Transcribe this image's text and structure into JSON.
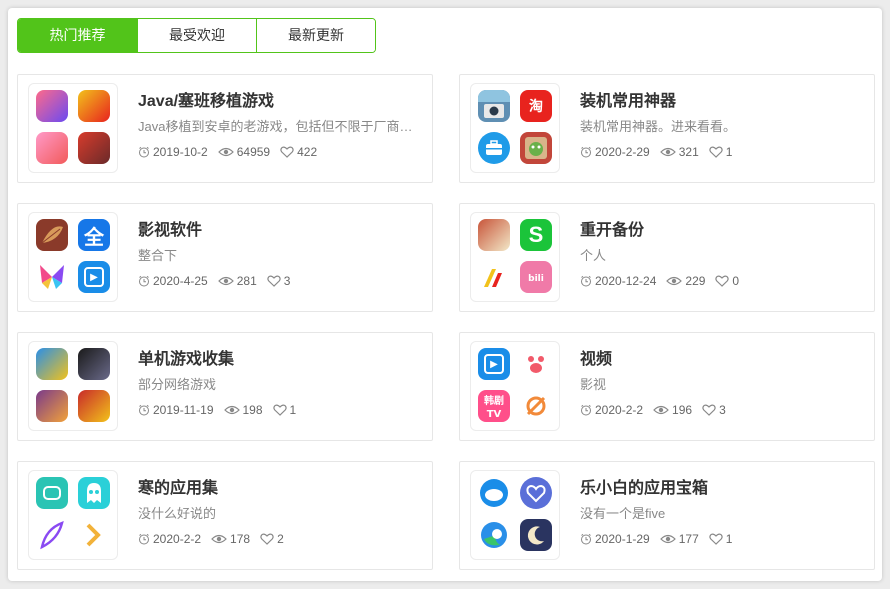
{
  "tabs": [
    {
      "label": "热门推荐",
      "active": true
    },
    {
      "label": "最受欢迎",
      "active": false
    },
    {
      "label": "最新更新",
      "active": false
    }
  ],
  "colors": {
    "accent": "#52c41a"
  },
  "cards": [
    {
      "title": "Java/塞班移植游戏",
      "desc": "Java移植到安卓的老游戏，包括但不限于厂商…",
      "date": "2019-10-2",
      "views": "64959",
      "likes": "422",
      "icons": [
        {
          "name": "game-icon",
          "bg": "#e8567a",
          "glyph": ""
        },
        {
          "name": "game-icon",
          "bg": "#f2c21b",
          "glyph": ""
        },
        {
          "name": "game-icon",
          "bg": "#f07aa8",
          "glyph": ""
        },
        {
          "name": "game-icon",
          "bg": "#d83c2c",
          "glyph": ""
        }
      ]
    },
    {
      "title": "装机常用神器",
      "desc": "装机常用神器。进来看看。",
      "date": "2020-2-29",
      "views": "321",
      "likes": "1",
      "icons": [
        {
          "name": "camera-app-icon",
          "bg": "#5f8fb3",
          "glyph": ""
        },
        {
          "name": "shop-app-icon",
          "bg": "#e8231e",
          "glyph": "淘"
        },
        {
          "name": "toolbox-app-icon",
          "bg": "#1f9be8",
          "glyph": ""
        },
        {
          "name": "robot-app-icon",
          "bg": "#c2463a",
          "glyph": ""
        }
      ]
    },
    {
      "title": "影视软件",
      "desc": "整合下",
      "date": "2020-4-25",
      "views": "281",
      "likes": "3",
      "icons": [
        {
          "name": "leaf-app-icon",
          "bg": "#8a3a2a",
          "glyph": ""
        },
        {
          "name": "video-app-icon",
          "bg": "#1677e8",
          "glyph": "全"
        },
        {
          "name": "butterfly-app-icon",
          "bg": "#f4a23a",
          "glyph": ""
        },
        {
          "name": "play-app-icon",
          "bg": "#1a8de8",
          "glyph": "▶"
        }
      ]
    },
    {
      "title": "重开备份",
      "desc": "个人",
      "date": "2020-12-24",
      "views": "229",
      "likes": "0",
      "icons": [
        {
          "name": "game-icon",
          "bg": "#c8553a",
          "glyph": ""
        },
        {
          "name": "s-app-icon",
          "bg": "#1bc43a",
          "glyph": "S"
        },
        {
          "name": "logo-app-icon",
          "bg": "#ffffff",
          "glyph": ""
        },
        {
          "name": "bilibili-app-icon",
          "bg": "#f07aa8",
          "glyph": ""
        }
      ]
    },
    {
      "title": "单机游戏收集",
      "desc": "部分网络游戏",
      "date": "2019-11-19",
      "views": "198",
      "likes": "1",
      "icons": [
        {
          "name": "game-icon",
          "bg": "#2a8fe8",
          "glyph": ""
        },
        {
          "name": "game-icon",
          "bg": "#2a2a2a",
          "glyph": ""
        },
        {
          "name": "game-icon",
          "bg": "#7a3a8a",
          "glyph": ""
        },
        {
          "name": "game-icon",
          "bg": "#c82a2a",
          "glyph": ""
        }
      ]
    },
    {
      "title": "视频",
      "desc": "影视",
      "date": "2020-2-2",
      "views": "196",
      "likes": "3",
      "icons": [
        {
          "name": "play-app-icon",
          "bg": "#1a8de8",
          "glyph": "▶"
        },
        {
          "name": "paw-app-icon",
          "bg": "#ffffff",
          "glyph": ""
        },
        {
          "name": "tv-app-icon",
          "bg": "#ff4f8a",
          "glyph": ""
        },
        {
          "name": "slash-app-icon",
          "bg": "#ffffff",
          "glyph": ""
        }
      ]
    },
    {
      "title": "寒的应用集",
      "desc": "没什么好说的",
      "date": "2020-2-2",
      "views": "178",
      "likes": "2",
      "icons": [
        {
          "name": "chat-app-icon",
          "bg": "#2ac4b4",
          "glyph": ""
        },
        {
          "name": "ghost-app-icon",
          "bg": "#2ad0d8",
          "glyph": ""
        },
        {
          "name": "feather-app-icon",
          "bg": "#ffffff",
          "glyph": ""
        },
        {
          "name": "arrow-app-icon",
          "bg": "#ffffff",
          "glyph": ""
        }
      ]
    },
    {
      "title": "乐小白的应用宝箱",
      "desc": "没有一个是five",
      "date": "2020-1-29",
      "views": "177",
      "likes": "1",
      "icons": [
        {
          "name": "cloud-app-icon",
          "bg": "#ffffff",
          "glyph": ""
        },
        {
          "name": "heart-app-icon",
          "bg": "#5a6fd8",
          "glyph": ""
        },
        {
          "name": "edge-app-icon",
          "bg": "#ffffff",
          "glyph": ""
        },
        {
          "name": "moon-app-icon",
          "bg": "#2a3460",
          "glyph": ""
        }
      ]
    }
  ]
}
